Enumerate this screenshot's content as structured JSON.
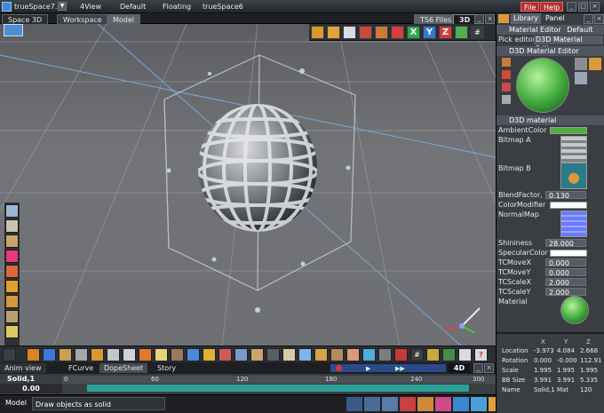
{
  "app": {
    "title": "trueSpace7.6",
    "layout_dropdown": "4View",
    "scene_dropdown": "Default",
    "mode_dropdown": "Floating",
    "style_dropdown": "trueSpace6",
    "menu_file": "File",
    "menu_help": "Help"
  },
  "tabs": {
    "space3d": "Space 3D",
    "workspace": "Workspace",
    "model": "Model",
    "ts6files": "TS6 Files",
    "view3d": "3D"
  },
  "panel": {
    "tabs": [
      "Library",
      "Panel"
    ],
    "material_editor_title": "Material Editor",
    "material_editor_value": "Default",
    "pick_editor_label": "Pick editor",
    "pick_editor_value": "D3D Material Editor",
    "d3d_material_editor_title": "D3D Material Editor",
    "d3d_material_title": "D3D material",
    "ambient_color_label": "AmbientColor",
    "ambient_color": "#4caf3a",
    "bitmap_a_label": "Bitmap A",
    "bitmap_b_label": "Bitmap B",
    "blendfactor_label": "BlendFactor, 1",
    "blendfactor_value": "0.130",
    "colormodifier_label": "ColorModifier",
    "normalmap_label": "NormalMap",
    "shininess_label": "Shininess",
    "shininess_value": "28.000",
    "specularcolor_label": "SpecularColor",
    "tcmovex_label": "TCMoveX",
    "tcmovex_value": "0.000",
    "tcmovey_label": "TCMoveY",
    "tcmovey_value": "0.000",
    "tcscalex_label": "TCScaleX",
    "tcscalex_value": "2.000",
    "tcscaley_label": "TCScaleY",
    "tcscaley_value": "2.000",
    "material_label": "Material"
  },
  "transform": {
    "headers": [
      "X",
      "Y",
      "Z"
    ],
    "rows": [
      {
        "label": "Location",
        "x": "-3.973",
        "y": "4.084",
        "z": "2.668"
      },
      {
        "label": "Rotation",
        "x": "0.000",
        "y": "-0.000",
        "z": "112.91"
      },
      {
        "label": "Scale",
        "x": "1.995",
        "y": "1.995",
        "z": "1.995"
      },
      {
        "label": "BB Size",
        "x": "3.991",
        "y": "3.991",
        "z": "5.335"
      },
      {
        "label": "Name",
        "x": "Solid,1",
        "y": "Mat",
        "z": "120"
      }
    ]
  },
  "anim": {
    "tabs": [
      "Anim view",
      "FCurve",
      "DopeSheet",
      "Story"
    ],
    "view4d": "4D",
    "object_name": "Solid,1",
    "time_value": "0.00",
    "ticks": [
      "0",
      "60",
      "120",
      "180",
      "240",
      "300"
    ]
  },
  "status": {
    "mode": "Model",
    "message": "Draw objects as solid"
  }
}
